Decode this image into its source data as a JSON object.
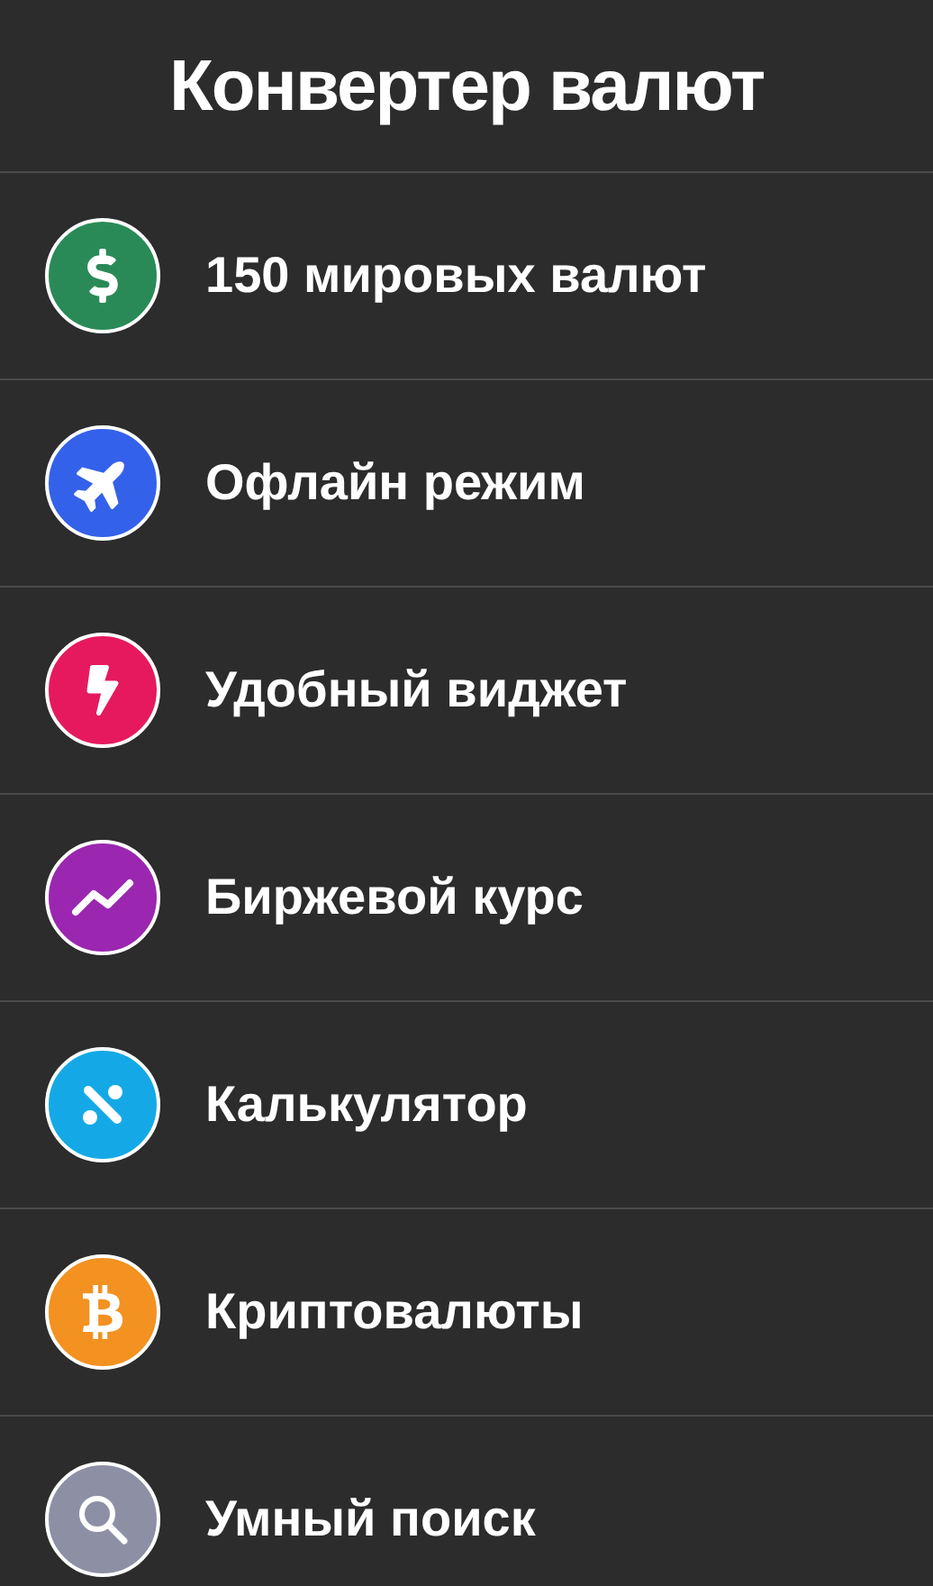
{
  "title": "Конвертер валют",
  "features": [
    {
      "label": "150 мировых валют",
      "kind": "dollar",
      "color": "#2a8a57"
    },
    {
      "label": "Офлайн режим",
      "kind": "plane",
      "color": "#3461e9"
    },
    {
      "label": "Удобный виджет",
      "kind": "bolt",
      "color": "#e6195f"
    },
    {
      "label": "Биржевой курс",
      "kind": "chart",
      "color": "#9b27b0"
    },
    {
      "label": "Калькулятор",
      "kind": "calculator",
      "color": "#14a9e6"
    },
    {
      "label": "Криптовалюты",
      "kind": "bitcoin",
      "color": "#f39121"
    },
    {
      "label": "Умный поиск",
      "kind": "search",
      "color": "#8d90a5"
    }
  ]
}
